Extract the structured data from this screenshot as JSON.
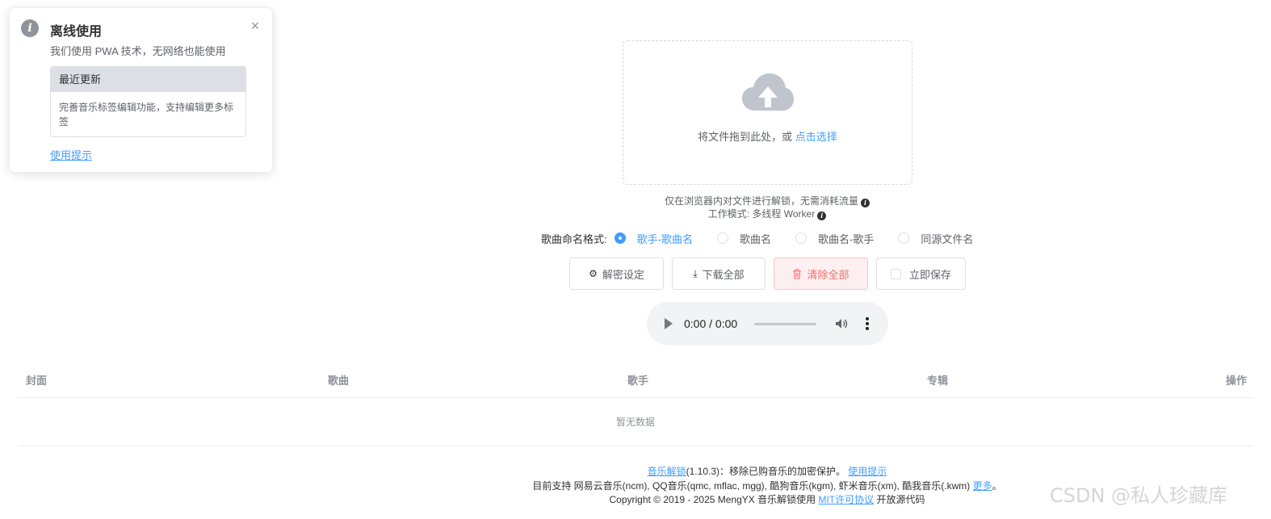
{
  "notification": {
    "title": "离线使用",
    "description": "我们使用 PWA 技术，无网络也能使用",
    "recent_header": "最近更新",
    "recent_body": "完善音乐标签编辑功能，支持编辑更多标签",
    "link": "使用提示",
    "close": "×"
  },
  "upload": {
    "text": "将文件拖到此处，或 ",
    "pick": "点击选择",
    "tip1": "仅在浏览器内对文件进行解锁，无需消耗流量",
    "tip2": "工作模式: 多线程 Worker"
  },
  "naming": {
    "label": "歌曲命名格式:",
    "options": [
      {
        "label": "歌手-歌曲名",
        "checked": true
      },
      {
        "label": "歌曲名",
        "checked": false
      },
      {
        "label": "歌曲名-歌手",
        "checked": false
      },
      {
        "label": "同源文件名",
        "checked": false
      }
    ]
  },
  "buttons": {
    "decrypt_settings": "解密设定",
    "download_all": "下载全部",
    "clear_all": "清除全部",
    "save_now": "立即保存"
  },
  "player": {
    "time": "0:00 / 0:00"
  },
  "table": {
    "headers": [
      "封面",
      "歌曲",
      "歌手",
      "专辑",
      "操作"
    ],
    "empty": "暂无数据"
  },
  "footer": {
    "app_link": "音乐解锁",
    "version": "(1.10.3)：移除已购音乐的加密保护。",
    "usage_link": "使用提示",
    "support": "目前支持 网易云音乐(ncm), QQ音乐(qmc, mflac, mgg), 酷狗音乐(kgm), 虾米音乐(xm), 酷我音乐(.kwm)",
    "more_link": "更多",
    "support_end": "。",
    "copyright": "Copyright © 2019 - 2025 MengYX 音乐解锁使用",
    "license_link": "MIT许可协议",
    "open_source": "开放源代码"
  },
  "watermark": "CSDN @私人珍藏库"
}
